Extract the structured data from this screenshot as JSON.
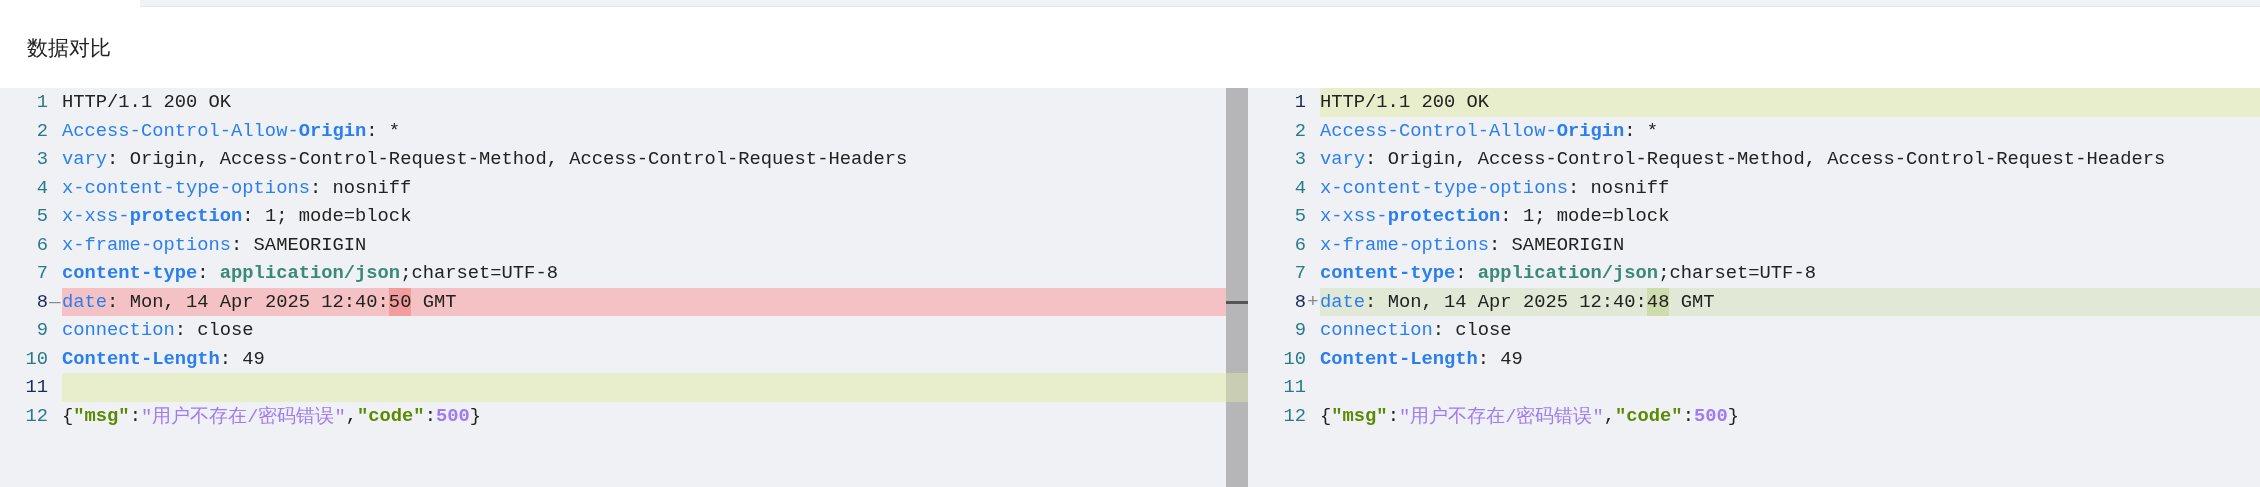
{
  "title": "数据对比",
  "panes": [
    {
      "lines": [
        {
          "number": "1",
          "kind": "plain",
          "tokens": [
            {
              "text": "HTTP/1.1 200 OK",
              "kind": "plain"
            }
          ]
        },
        {
          "number": "2",
          "kind": "plain",
          "tokens": [
            {
              "text": "Access-Control-Allow-",
              "kind": "key"
            },
            {
              "text": "Origin",
              "kind": "key-bold"
            },
            {
              "text": ": *",
              "kind": "plain"
            }
          ]
        },
        {
          "number": "3",
          "kind": "plain",
          "tokens": [
            {
              "text": "vary",
              "kind": "key"
            },
            {
              "text": ": Origin, Access-Control-Request-Method, Access-Control-Request-Headers",
              "kind": "plain"
            }
          ]
        },
        {
          "number": "4",
          "kind": "plain",
          "tokens": [
            {
              "text": "x-content-type-options",
              "kind": "key"
            },
            {
              "text": ": nosniff",
              "kind": "plain"
            }
          ]
        },
        {
          "number": "5",
          "kind": "plain",
          "tokens": [
            {
              "text": "x-xss-",
              "kind": "key"
            },
            {
              "text": "protection",
              "kind": "key-bold"
            },
            {
              "text": ": 1; mode=block",
              "kind": "plain"
            }
          ]
        },
        {
          "number": "6",
          "kind": "plain",
          "tokens": [
            {
              "text": "x-frame-options",
              "kind": "key"
            },
            {
              "text": ": SAMEORIGIN",
              "kind": "plain"
            }
          ]
        },
        {
          "number": "7",
          "kind": "plain",
          "tokens": [
            {
              "text": "content-type",
              "kind": "key-bold"
            },
            {
              "text": ": ",
              "kind": "plain"
            },
            {
              "text": "application/json",
              "kind": "type"
            },
            {
              "text": ";charset=UTF-8",
              "kind": "plain"
            }
          ]
        },
        {
          "number": "8",
          "kind": "removed",
          "marker": "—",
          "tokens": [
            {
              "text": "date",
              "kind": "key"
            },
            {
              "text": ": Mon, 14 Apr 2025 12:40:",
              "kind": "plain"
            },
            {
              "text": "50",
              "kind": "changed"
            },
            {
              "text": " GMT",
              "kind": "plain"
            }
          ]
        },
        {
          "number": "9",
          "kind": "plain",
          "tokens": [
            {
              "text": "connection",
              "kind": "key"
            },
            {
              "text": ": close",
              "kind": "plain"
            }
          ]
        },
        {
          "number": "10",
          "kind": "plain",
          "tokens": [
            {
              "text": "Content-Length",
              "kind": "key-bold"
            },
            {
              "text": ": 49",
              "kind": "plain"
            }
          ]
        },
        {
          "number": "11",
          "kind": "added"
        },
        {
          "number": "12",
          "kind": "plain",
          "tokens": [
            {
              "text": "{",
              "kind": "plain"
            },
            {
              "text": "\"msg\"",
              "kind": "json-key"
            },
            {
              "text": ":",
              "kind": "plain"
            },
            {
              "text": "\"用户不存在/密码错误\"",
              "kind": "json-string"
            },
            {
              "text": ",",
              "kind": "plain"
            },
            {
              "text": "\"code\"",
              "kind": "json-key"
            },
            {
              "text": ":",
              "kind": "plain"
            },
            {
              "text": "500",
              "kind": "json-number"
            },
            {
              "text": "}",
              "kind": "plain"
            }
          ]
        }
      ]
    },
    {
      "lines": [
        {
          "number": "1",
          "kind": "added",
          "tokens": [
            {
              "text": "HTTP/1.1 200 OK",
              "kind": "plain"
            }
          ]
        },
        {
          "number": "2",
          "kind": "plain",
          "tokens": [
            {
              "text": "Access-Control-Allow-",
              "kind": "key"
            },
            {
              "text": "Origin",
              "kind": "key-bold"
            },
            {
              "text": ": *",
              "kind": "plain"
            }
          ]
        },
        {
          "number": "3",
          "kind": "plain",
          "tokens": [
            {
              "text": "vary",
              "kind": "key"
            },
            {
              "text": ": Origin, Access-Control-Request-Method, Access-Control-Request-Headers",
              "kind": "plain"
            }
          ]
        },
        {
          "number": "4",
          "kind": "plain",
          "tokens": [
            {
              "text": "x-content-type-options",
              "kind": "key"
            },
            {
              "text": ": nosniff",
              "kind": "plain"
            }
          ]
        },
        {
          "number": "5",
          "kind": "plain",
          "tokens": [
            {
              "text": "x-xss-",
              "kind": "key"
            },
            {
              "text": "protection",
              "kind": "key-bold"
            },
            {
              "text": ": 1; mode=block",
              "kind": "plain"
            }
          ]
        },
        {
          "number": "6",
          "kind": "plain",
          "tokens": [
            {
              "text": "x-frame-options",
              "kind": "key"
            },
            {
              "text": ": SAMEORIGIN",
              "kind": "plain"
            }
          ]
        },
        {
          "number": "7",
          "kind": "plain",
          "tokens": [
            {
              "text": "content-type",
              "kind": "key-bold"
            },
            {
              "text": ": ",
              "kind": "plain"
            },
            {
              "text": "application/json",
              "kind": "type"
            },
            {
              "text": ";charset=UTF-8",
              "kind": "plain"
            }
          ]
        },
        {
          "number": "8",
          "kind": "modified",
          "marker": "+",
          "tokens": [
            {
              "text": "date",
              "kind": "key"
            },
            {
              "text": ": Mon, 14 Apr 2025 12:40:",
              "kind": "plain"
            },
            {
              "text": "48",
              "kind": "changed"
            },
            {
              "text": " GMT",
              "kind": "plain"
            }
          ]
        },
        {
          "number": "9",
          "kind": "plain",
          "tokens": [
            {
              "text": "connection",
              "kind": "key"
            },
            {
              "text": ": close",
              "kind": "plain"
            }
          ]
        },
        {
          "number": "10",
          "kind": "plain",
          "tokens": [
            {
              "text": "Content-Length",
              "kind": "key-bold"
            },
            {
              "text": ": 49",
              "kind": "plain"
            }
          ]
        },
        {
          "number": "11",
          "kind": "plain"
        },
        {
          "number": "12",
          "kind": "plain",
          "tokens": [
            {
              "text": "{",
              "kind": "plain"
            },
            {
              "text": "\"msg\"",
              "kind": "json-key"
            },
            {
              "text": ":",
              "kind": "plain"
            },
            {
              "text": "\"用户不存在/密码错误\"",
              "kind": "json-string"
            },
            {
              "text": ",",
              "kind": "plain"
            },
            {
              "text": "\"code\"",
              "kind": "json-key"
            },
            {
              "text": ":",
              "kind": "plain"
            },
            {
              "text": "500",
              "kind": "json-number"
            },
            {
              "text": "}",
              "kind": "plain"
            }
          ]
        }
      ]
    }
  ]
}
